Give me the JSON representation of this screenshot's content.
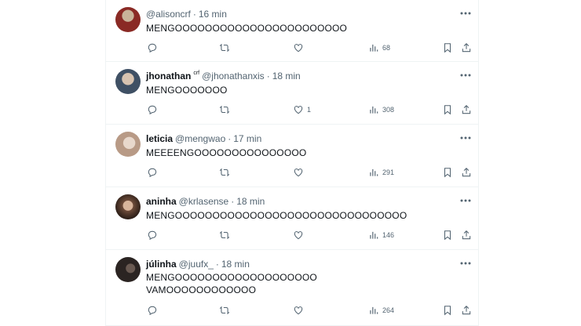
{
  "tweets": [
    {
      "display_name": "",
      "badge": "",
      "handle": "@alisoncrf",
      "time": "16 min",
      "text": "MENGOOOOOOOOOOOOOOOOOOOOOOO",
      "likes": "",
      "views": "68",
      "avatar_color": "#8a2a25"
    },
    {
      "display_name": "jhonathan",
      "badge": "crf",
      "handle": "@jhonathanxis",
      "time": "18 min",
      "text": "MENGOOOOOOO",
      "likes": "1",
      "views": "308",
      "avatar_color": "#3f5064"
    },
    {
      "display_name": "leticia",
      "badge": "",
      "handle": "@mengwao",
      "time": "17 min",
      "text": "MEEEENGOOOOOOOOOOOOOOO",
      "likes": "",
      "views": "291",
      "avatar_color": "#b89a86"
    },
    {
      "display_name": "aninha",
      "badge": "",
      "handle": "@krlasense",
      "time": "18 min",
      "text": "MENGOOOOOOOOOOOOOOOOOOOOOOOOOOOOOOO",
      "likes": "",
      "views": "146",
      "avatar_color": "#6e4c3a"
    },
    {
      "display_name": "júlinha",
      "badge": "",
      "handle": "@juufx_",
      "time": "18 min",
      "text": "MENGOOOOOOOOOOOOOOOOOOO\nVAMOOOOOOOOOOOO",
      "likes": "",
      "views": "264",
      "avatar_color": "#2b2422"
    }
  ],
  "separator": "·",
  "colors": {
    "text": "#0f1419",
    "secondary": "#536471",
    "border": "#eff3f4"
  },
  "icons": [
    "more-icon",
    "reply-icon",
    "retweet-icon",
    "like-icon",
    "views-icon",
    "bookmark-icon",
    "share-icon"
  ]
}
